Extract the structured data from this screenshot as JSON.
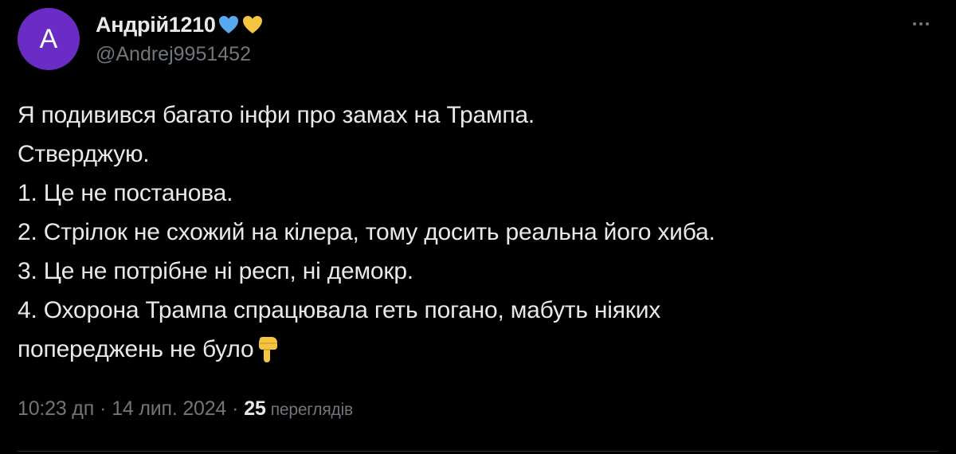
{
  "author": {
    "avatar_letter": "A",
    "display_name": "Андрій1210",
    "handle": "@Andrej9951452",
    "avatar_color": "#6a2cc4"
  },
  "badges": [
    "blue-heart-icon",
    "yellow-heart-icon"
  ],
  "tweet": {
    "lines": [
      "Я подивився багато інфи про замах на Трампа.",
      "Стверджую.",
      "1. Це не постанова.",
      "2. Стрілок не схожий на кілера, тому досить реальна його хиба.",
      "3. Це не потрібне ні респ, ні демокр.",
      "4. Охорона Трампа спрацювала геть погано, мабуть ніяких",
      "попереджень не було"
    ],
    "trailing_emoji": "pointing-down-icon"
  },
  "meta": {
    "time": "10:23 дп",
    "separator": "·",
    "date": "14 лип. 2024",
    "views_count": "25",
    "views_label": "переглядів"
  },
  "colors": {
    "background": "#000000",
    "text": "#e7e9ea",
    "secondary": "#71767b",
    "heart_blue": "#5aa9f0",
    "heart_yellow": "#f5c542"
  }
}
